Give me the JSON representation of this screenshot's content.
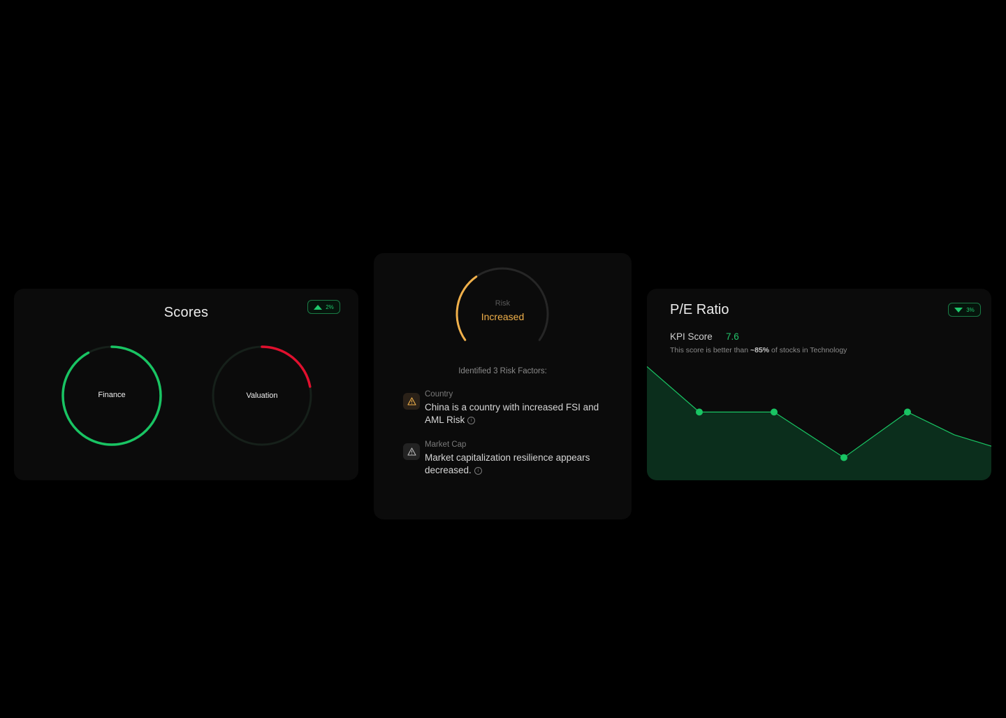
{
  "scores": {
    "title": "Scores",
    "change_badge": {
      "direction": "up",
      "value": "2%"
    },
    "gauges": [
      {
        "label": "Finance",
        "fraction": 0.92,
        "color": "#19c463"
      },
      {
        "label": "Valuation",
        "fraction": 0.22,
        "color": "#e0102e"
      }
    ]
  },
  "risk": {
    "label_small": "Risk",
    "label_big": "Increased",
    "gauge_fraction": 0.36,
    "gauge_color": "#f0b04a",
    "heading": "Identified 3 Risk Factors:",
    "factors": [
      {
        "category": "Country",
        "description": "China is a country with increased FSI and AML Risk",
        "icon": "warning-icon",
        "icon_color": "#f0b04a"
      },
      {
        "category": "Market Cap",
        "description": "Market capitalization resilience appears decreased.",
        "icon": "warning-icon",
        "icon_color": "#bdbdbd"
      }
    ]
  },
  "pe_ratio": {
    "title": "P/E Ratio",
    "change_badge": {
      "direction": "down",
      "value": "3%"
    },
    "kpi_label": "KPI Score",
    "kpi_value": "7.6",
    "note_prefix": "This score is better than ",
    "note_highlight": "~85%",
    "note_suffix": " of stocks in Technology",
    "series_color": "#19c463",
    "fill_color": "#0b2e1c"
  },
  "chart_data": {
    "type": "area",
    "x": [
      0,
      1,
      2,
      3,
      4,
      5,
      6
    ],
    "values": [
      7.6,
      6.8,
      6.8,
      6.0,
      6.8,
      6.4,
      6.2
    ],
    "markers": [
      false,
      true,
      true,
      true,
      true,
      false,
      false
    ],
    "title": "",
    "xlabel": "",
    "ylabel": "",
    "ylim": [
      5.6,
      7.8
    ],
    "grid": false
  }
}
